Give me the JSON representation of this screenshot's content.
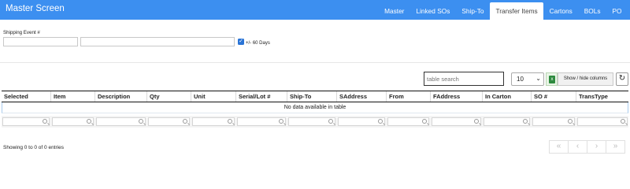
{
  "app": {
    "title": "Master Screen"
  },
  "tabs": [
    {
      "label": "Master",
      "active": false
    },
    {
      "label": "Linked SOs",
      "active": false
    },
    {
      "label": "Ship-To",
      "active": false
    },
    {
      "label": "Transfer Items",
      "active": true
    },
    {
      "label": "Cartons",
      "active": false
    },
    {
      "label": "BOLs",
      "active": false
    },
    {
      "label": "PO",
      "active": false
    }
  ],
  "form": {
    "shipping_event_label": "Shipping Event #",
    "shipping_event_value": "",
    "shipping_event_detail": "",
    "days_checkbox_checked": true,
    "days_checkbox_label": "+/- 60 Days"
  },
  "toolbar": {
    "search_placeholder": "table search",
    "page_length": "10",
    "show_hide_label": "Show / hide columns",
    "excel_icon": "excel-export-icon",
    "refresh_icon": "refresh-icon"
  },
  "table": {
    "columns": [
      "Selected",
      "Item",
      "Description",
      "Qty",
      "Unit",
      "Serial/Lot #",
      "Ship-To",
      "SAddress",
      "From",
      "FAddress",
      "In Carton",
      "SO #",
      "TransType"
    ],
    "empty_message": "No data available in table",
    "rows": []
  },
  "footer": {
    "info": "Showing 0 to 0 of 0 entries",
    "pager": [
      "«",
      "‹",
      "›",
      "»"
    ]
  },
  "colors": {
    "accent": "#3c8ff0",
    "checkbox": "#2a74d6"
  }
}
